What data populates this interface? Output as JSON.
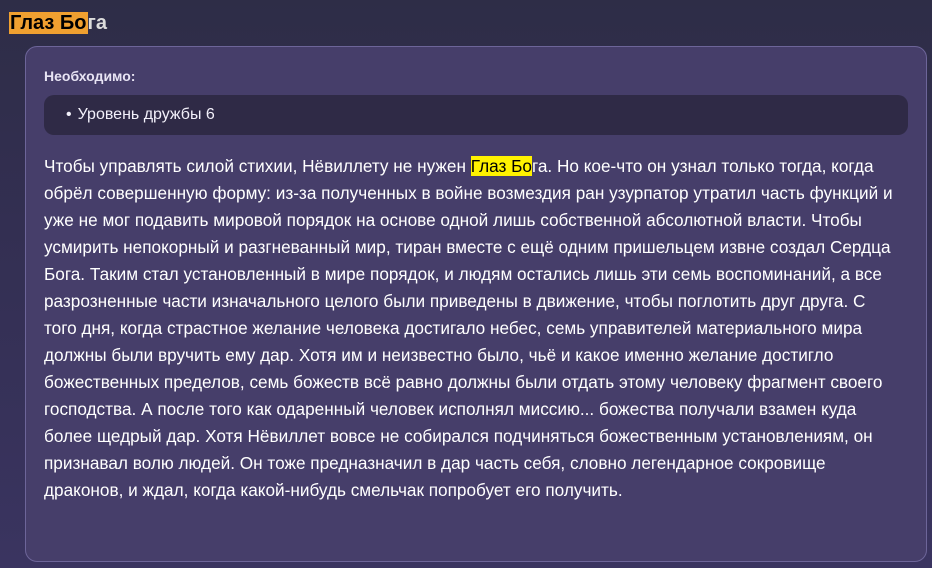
{
  "title": {
    "highlighted": "Глаз Бо",
    "rest": "га"
  },
  "requirements": {
    "label": "Необходимо:",
    "items": [
      "Уровень дружбы 6"
    ]
  },
  "description": {
    "before": "Чтобы управлять силой стихии, Нёвиллету не нужен ",
    "highlighted": "Глаз Бо",
    "after": "га. Но кое-что он узнал только тогда, когда обрёл совершенную форму: из-за полученных в войне возмездия ран узурпатор утратил часть функций и уже не мог подавить мировой порядок на основе одной лишь собственной абсолютной власти. Чтобы усмирить непокорный и разгневанный мир, тиран вместе с ещё одним пришельцем извне создал Сердца Бога. Таким стал установленный в мире порядок, и людям остались лишь эти семь воспоминаний, а все разрозненные части изначального целого были приведены в движение, чтобы поглотить друг друга. С того дня, когда страстное желание человека достигало небес, семь управителей материального мира должны были вручить ему дар. Хотя им и неизвестно было, чьё и какое именно желание достигло божественных пределов, семь божеств всё равно должны были отдать этому человеку фрагмент своего господства. А после того как одаренный человек исполнял миссию... божества получали взамен куда более щедрый дар. Хотя Нёвиллет вовсе не собирался подчиняться божественным установлениям, он признавал волю людей. Он тоже предназначил в дар часть себя, словно легендарное сокровище драконов, и ждал, когда какой-нибудь смельчак попробует его получить."
  },
  "colors": {
    "title_highlight": "#f0a030",
    "inline_highlight": "#fff200",
    "card_bg": "#463e6a",
    "requirement_box_bg": "#2f2a46"
  }
}
